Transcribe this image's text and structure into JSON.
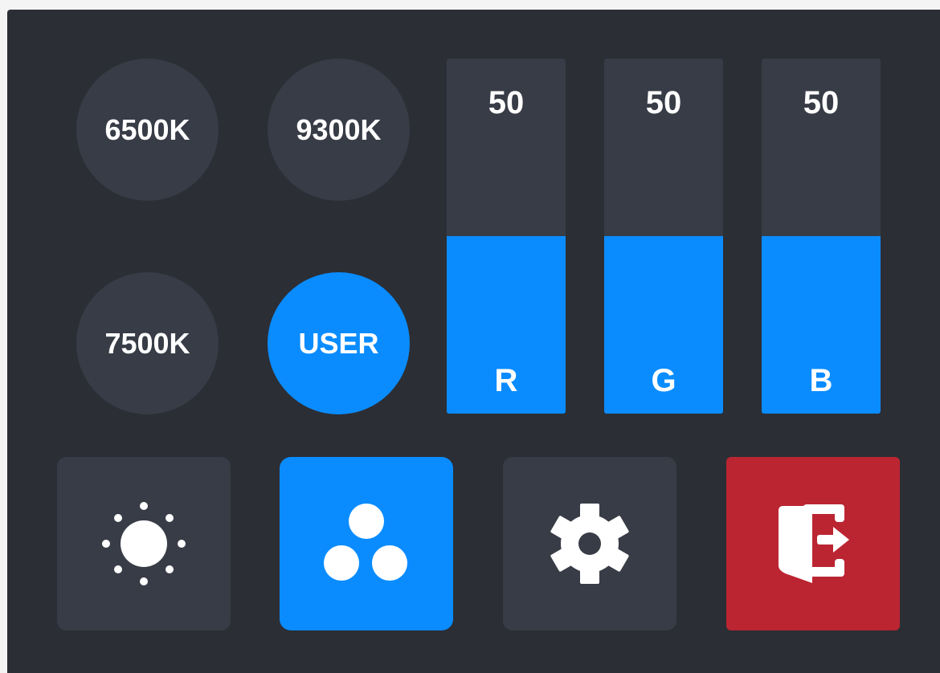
{
  "colors": {
    "background": "#2b2e35",
    "surface": "#373c46",
    "accent": "#0a8cff",
    "danger": "#bb2531",
    "text": "#ffffff"
  },
  "presets": [
    {
      "label": "6500K",
      "selected": false
    },
    {
      "label": "9300K",
      "selected": false
    },
    {
      "label": "7500K",
      "selected": false
    },
    {
      "label": "USER",
      "selected": true
    }
  ],
  "rgb_sliders": [
    {
      "channel": "R",
      "value": "50",
      "level_percent": 50
    },
    {
      "channel": "G",
      "value": "50",
      "level_percent": 50
    },
    {
      "channel": "B",
      "value": "50",
      "level_percent": 50
    }
  ],
  "bottom_buttons": [
    {
      "icon": "brightness-icon",
      "active": false
    },
    {
      "icon": "color-circles-icon",
      "active": true
    },
    {
      "icon": "gear-icon",
      "active": false
    },
    {
      "icon": "exit-icon",
      "active": false
    }
  ]
}
